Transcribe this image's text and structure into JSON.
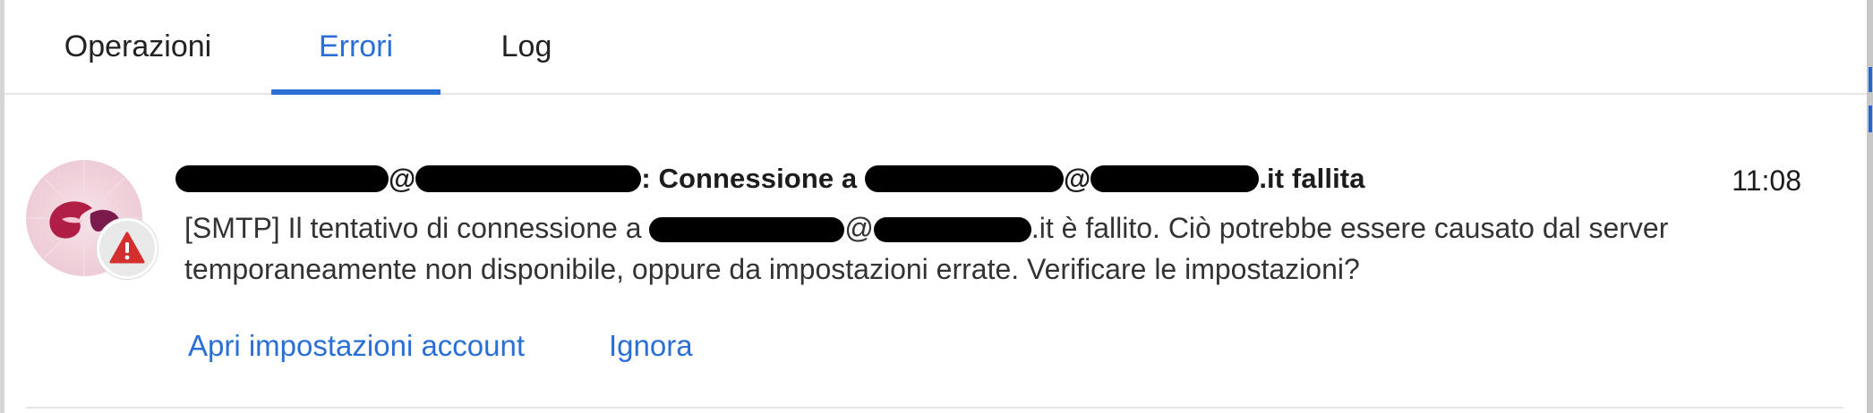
{
  "tabs": [
    {
      "label": "Operazioni",
      "active": false
    },
    {
      "label": "Errori",
      "active": true
    },
    {
      "label": "Log",
      "active": false
    }
  ],
  "notification": {
    "title_sep": "@",
    "title_mid": ": Connessione a",
    "title_at": "@",
    "title_end": ".it fallita",
    "time": "11:08",
    "body_prefix": "[SMTP] Il tentativo di connessione a",
    "body_at": "@",
    "body_suffix": ".it è fallito. Ciò potrebbe essere causato dal server temporaneamente non disponibile, oppure da impostazioni errate. Verificare le impostazioni?",
    "icon": "warning-icon",
    "avatar_icon": "app-logo"
  },
  "actions": {
    "open_settings": "Apri impostazioni account",
    "ignore": "Ignora"
  },
  "colors": {
    "accent": "#2a6fd6",
    "warning": "#d32f2f"
  }
}
